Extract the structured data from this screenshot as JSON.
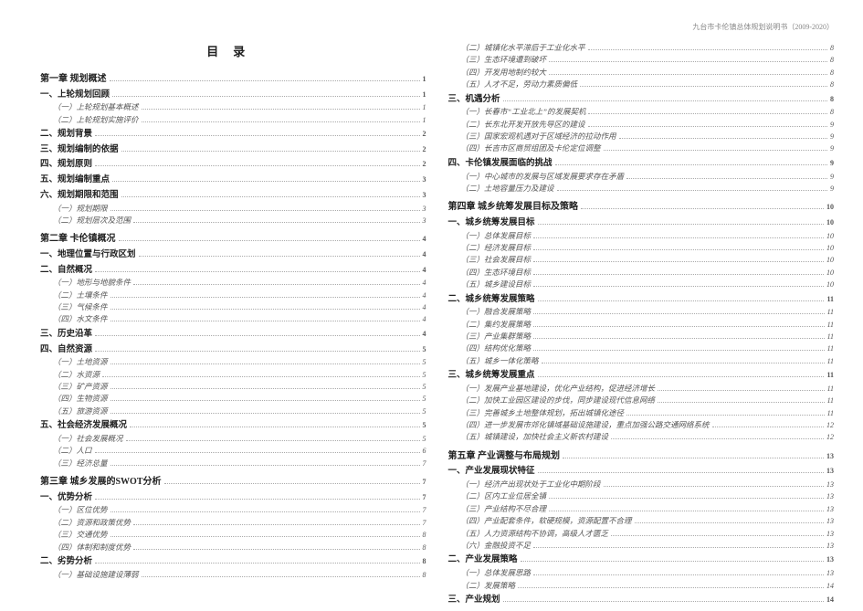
{
  "header_text": "九台市卡伦镇总体规划说明书（2009-2020）",
  "toc_title": "目录",
  "left_column": [
    {
      "level": "chapter",
      "label": "第一章  规划概述",
      "page": "1"
    },
    {
      "level": "section",
      "label": "一、上轮规划回顾",
      "page": "1"
    },
    {
      "level": "sub",
      "label": "（一）上轮规划基本概述",
      "page": "1"
    },
    {
      "level": "sub",
      "label": "（二）上轮规划实施评价",
      "page": "1"
    },
    {
      "level": "section",
      "label": "二、规划背景",
      "page": "2"
    },
    {
      "level": "section",
      "label": "三、规划编制的依据",
      "page": "2"
    },
    {
      "level": "section",
      "label": "四、规划原则",
      "page": "2"
    },
    {
      "level": "section",
      "label": "五、规划编制重点",
      "page": "3"
    },
    {
      "level": "section",
      "label": "六、规划期限和范围",
      "page": "3"
    },
    {
      "level": "sub",
      "label": "（一）规划期限",
      "page": "3"
    },
    {
      "level": "sub",
      "label": "（二）规划层次及范围",
      "page": "3"
    },
    {
      "level": "chapter",
      "label": "第二章  卡伦镇概况",
      "page": "4"
    },
    {
      "level": "section",
      "label": "一、地理位置与行政区划",
      "page": "4"
    },
    {
      "level": "section",
      "label": "二、自然概况",
      "page": "4"
    },
    {
      "level": "sub",
      "label": "（一）地形与地貌条件",
      "page": "4"
    },
    {
      "level": "sub",
      "label": "（二）土壤条件",
      "page": "4"
    },
    {
      "level": "sub",
      "label": "（三）气候条件",
      "page": "4"
    },
    {
      "level": "sub",
      "label": "（四）水文条件",
      "page": "4"
    },
    {
      "level": "section",
      "label": "三、历史沿革",
      "page": "4"
    },
    {
      "level": "section",
      "label": "四、自然资源",
      "page": "5"
    },
    {
      "level": "sub",
      "label": "（一）土地资源",
      "page": "5"
    },
    {
      "level": "sub",
      "label": "（二）水资源",
      "page": "5"
    },
    {
      "level": "sub",
      "label": "（三）矿产资源",
      "page": "5"
    },
    {
      "level": "sub",
      "label": "（四）生物资源",
      "page": "5"
    },
    {
      "level": "sub",
      "label": "（五）旅游资源",
      "page": "5"
    },
    {
      "level": "section",
      "label": "五、社会经济发展概况",
      "page": "5"
    },
    {
      "level": "sub",
      "label": "（一）社会发展概况",
      "page": "5"
    },
    {
      "level": "sub",
      "label": "（二）人口",
      "page": "6"
    },
    {
      "level": "sub",
      "label": "（三）经济总量",
      "page": "7"
    },
    {
      "level": "chapter",
      "label": "第三章  城乡发展的SWOT分析",
      "page": "7"
    },
    {
      "level": "section",
      "label": "一、优势分析",
      "page": "7"
    },
    {
      "level": "sub",
      "label": "（一）区位优势",
      "page": "7"
    },
    {
      "level": "sub",
      "label": "（二）资源和政策优势",
      "page": "7"
    },
    {
      "level": "sub",
      "label": "（三）交通优势",
      "page": "8"
    },
    {
      "level": "sub",
      "label": "（四）体制和制度优势",
      "page": "8"
    },
    {
      "level": "section",
      "label": "二、劣势分析",
      "page": "8"
    },
    {
      "level": "sub",
      "label": "（一）基础设施建设薄弱",
      "page": "8"
    }
  ],
  "right_column": [
    {
      "level": "sub",
      "label": "（二）城镇化水平滞后于工业化水平",
      "page": "8"
    },
    {
      "level": "sub",
      "label": "（三）生态环境遭到破坏",
      "page": "8"
    },
    {
      "level": "sub",
      "label": "（四）开发用地制约较大",
      "page": "8"
    },
    {
      "level": "sub",
      "label": "（五）人才不足，劳动力素质偏低",
      "page": "8"
    },
    {
      "level": "section",
      "label": "三、机遇分析",
      "page": "8"
    },
    {
      "level": "sub",
      "label": "（一）长春市“工业北上”的发展契机",
      "page": "8"
    },
    {
      "level": "sub",
      "label": "（二）长东北开发开放先导区的建设",
      "page": "9"
    },
    {
      "level": "sub",
      "label": "（三）国家宏观机遇对于区域经济的拉动作用",
      "page": "9"
    },
    {
      "level": "sub",
      "label": "（四）长吉市区商贸组团及卡伦定位调整",
      "page": "9"
    },
    {
      "level": "section",
      "label": "四、卡伦镇发展面临的挑战",
      "page": "9"
    },
    {
      "level": "sub",
      "label": "（一）中心城市的发展与区域发展要求存在矛盾",
      "page": "9"
    },
    {
      "level": "sub",
      "label": "（二）土地容量压力及建设",
      "page": "9"
    },
    {
      "level": "chapter",
      "label": "第四章  城乡统筹发展目标及策略",
      "page": "10"
    },
    {
      "level": "section",
      "label": "一、城乡统筹发展目标",
      "page": "10"
    },
    {
      "level": "sub",
      "label": "（一）总体发展目标",
      "page": "10"
    },
    {
      "level": "sub",
      "label": "（二）经济发展目标",
      "page": "10"
    },
    {
      "level": "sub",
      "label": "（三）社会发展目标",
      "page": "10"
    },
    {
      "level": "sub",
      "label": "（四）生态环境目标",
      "page": "10"
    },
    {
      "level": "sub",
      "label": "（五）城乡建设目标",
      "page": "10"
    },
    {
      "level": "section",
      "label": "二、城乡统筹发展策略",
      "page": "11"
    },
    {
      "level": "sub",
      "label": "（一）融合发展策略",
      "page": "11"
    },
    {
      "level": "sub",
      "label": "（二）集约发展策略",
      "page": "11"
    },
    {
      "level": "sub",
      "label": "（三）产业集群策略",
      "page": "11"
    },
    {
      "level": "sub",
      "label": "（四）结构优化策略",
      "page": "11"
    },
    {
      "level": "sub",
      "label": "（五）城乡一体化策略",
      "page": "11"
    },
    {
      "level": "section",
      "label": "三、城乡统筹发展重点",
      "page": "11"
    },
    {
      "level": "sub",
      "label": "（一）发展产业基地建设，优化产业结构，促进经济增长",
      "page": "11"
    },
    {
      "level": "sub",
      "label": "（二）加快工业园区建设的步伐，同步建设现代信息网络",
      "page": "11"
    },
    {
      "level": "sub",
      "label": "（三）完善城乡土地整体规划，拓出城镇化途径",
      "page": "11"
    },
    {
      "level": "sub",
      "label": "（四）进一步发展市郊化镇域基础设施建设，重点加强公路交通网络系统",
      "page": "12"
    },
    {
      "level": "sub",
      "label": "（五）城镇建设，加快社会主义新农村建设",
      "page": "12"
    },
    {
      "level": "chapter",
      "label": "第五章  产业调整与布局规划",
      "page": "13"
    },
    {
      "level": "section",
      "label": "一、产业发展现状特征",
      "page": "13"
    },
    {
      "level": "sub",
      "label": "（一）经济产出现状处于工业化中期阶段",
      "page": "13"
    },
    {
      "level": "sub",
      "label": "（二）区内工业位居全镇",
      "page": "13"
    },
    {
      "level": "sub",
      "label": "（三）产业结构不尽合理",
      "page": "13"
    },
    {
      "level": "sub",
      "label": "（四）产业配套条件，软硬规模，资源配置不合理",
      "page": "13"
    },
    {
      "level": "sub",
      "label": "（五）人力资源结构不协调，高级人才匮乏",
      "page": "13"
    },
    {
      "level": "sub",
      "label": "（六）金融投资不足",
      "page": "13"
    },
    {
      "level": "section",
      "label": "二、产业发展策略",
      "page": "13"
    },
    {
      "level": "sub",
      "label": "（一）总体发展思路",
      "page": "13"
    },
    {
      "level": "sub",
      "label": "（二）发展策略",
      "page": "14"
    },
    {
      "level": "section",
      "label": "三、产业规划",
      "page": "14"
    }
  ]
}
